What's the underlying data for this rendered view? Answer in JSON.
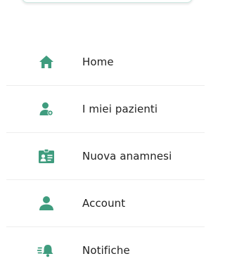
{
  "colors": {
    "accent": "#3f9c7e",
    "text": "#222222",
    "divider": "#ededed"
  },
  "menu": {
    "items": [
      {
        "label": "Home",
        "icon": "home-icon"
      },
      {
        "label": "I miei pazienti",
        "icon": "patients-icon"
      },
      {
        "label": "Nuova anamnesi",
        "icon": "anamnesis-icon"
      },
      {
        "label": "Account",
        "icon": "account-icon"
      },
      {
        "label": "Notifiche",
        "icon": "bell-icon"
      }
    ]
  }
}
